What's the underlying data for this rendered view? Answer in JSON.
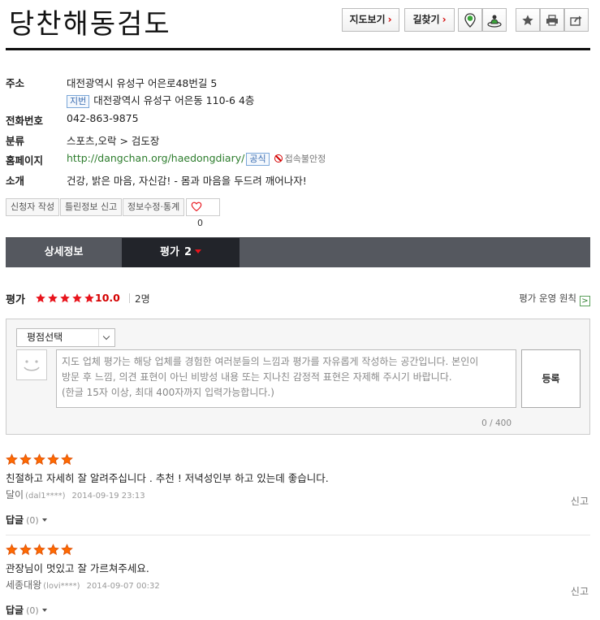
{
  "place": {
    "name": "당찬해동검도"
  },
  "toolbar": {
    "map_label": "지도보기",
    "route_label": "길찾기",
    "icons": [
      "pin-icon",
      "street-view-icon",
      "favorite-star-icon",
      "print-icon",
      "share-icon"
    ]
  },
  "info": {
    "address_label": "주소",
    "address": "대전광역시 유성구 어은로48번길 5",
    "jibun_tag": "지번",
    "jibun_address": "대전광역시 유성구 어은동 110-6 4층",
    "phone_label": "전화번호",
    "phone": "042-863-9875",
    "category_label": "분류",
    "category": "스포츠,오락 > 검도장",
    "homepage_label": "홈페이지",
    "homepage_url": "http://dangchan.org/haedongdiary/",
    "official_tag": "공식",
    "connection_status": "접속불안정",
    "intro_label": "소개",
    "intro": "건강, 밝은 마음, 자신감! - 몸과 마음을 두드려 깨어나자!"
  },
  "actions": {
    "applicant": "신청자 작성",
    "report_error": "틀린정보 신고",
    "edit_stats": "정보수정·통계",
    "like_count": "0"
  },
  "tabs": {
    "detail": "상세정보",
    "rating": "평가",
    "rating_count": "2"
  },
  "rating": {
    "title": "평가",
    "stars": 5,
    "score": "10.0",
    "people": "2명",
    "policy": "평가 운영 원칙",
    "policy_arrow": ">"
  },
  "write": {
    "select_label": "평점선택",
    "placeholder": "지도 업체 평가는 해당 업체를 경험한 여러분들의 느낌과 평가를 자유롭게 작성하는 공간입니다. 본인이\n방문 후 느낌, 의견 표현이 아닌 비방성 내용 또는 지나친 감정적 표현은 자제해 주시기 바랍니다.\n(한글 15자 이상, 최대 400자까지 입력가능합니다.)",
    "submit": "등록",
    "counter": "0 / 400"
  },
  "reviews": [
    {
      "stars": 5,
      "text": "친절하고 자세히 잘 알려주십니다 . 추천 ! 저녁성인부 하고 있는데 좋습니다.",
      "author": "달이",
      "user_id": "(dal1****)",
      "date": "2014-09-19 23:13",
      "report": "신고",
      "reply_label": "답글",
      "reply_count": "(0)"
    },
    {
      "stars": 5,
      "text": "관장님이 멋있고 잘 가르쳐주세요.",
      "author": "세종대왕",
      "user_id": "(lovi****)",
      "date": "2014-09-07 00:32",
      "report": "신고",
      "reply_label": "답글",
      "reply_count": "(0)"
    }
  ],
  "colors": {
    "accent_red": "#d40000",
    "star_red": "#e8141c",
    "review_star_orange": "#ff6a00",
    "tab_bg": "#55585f",
    "tab_active_bg": "#22242a",
    "link_green": "#2d7d2d"
  }
}
